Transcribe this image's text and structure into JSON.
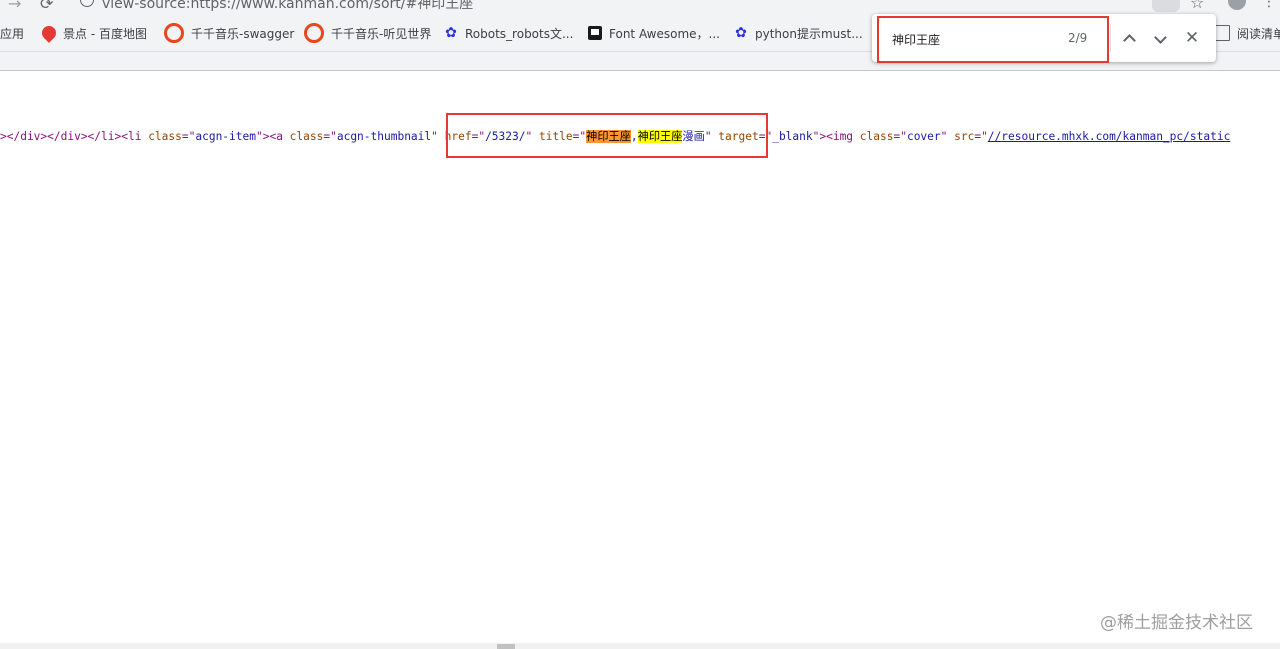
{
  "browser": {
    "url": "view-source:https://www.kanman.com/sort/#神印王座"
  },
  "bookmarks": [
    {
      "label": "应用",
      "icon": "apps-icon"
    },
    {
      "label": "景点 - 百度地图",
      "icon": "map-pin-icon"
    },
    {
      "label": "千千音乐-swagger",
      "icon": "qianqian-icon"
    },
    {
      "label": "千千音乐-听见世界",
      "icon": "qianqian-icon"
    },
    {
      "label": "Robots_robots文...",
      "icon": "baidu-paw-icon"
    },
    {
      "label": "Font Awesome，...",
      "icon": "flag-icon"
    },
    {
      "label": "python提示must...",
      "icon": "baidu-paw-icon"
    },
    {
      "label": "阅读清单",
      "icon": "reading-list-icon"
    }
  ],
  "find": {
    "query": "神印王座",
    "count": "2/9"
  },
  "source": {
    "t01": "></div></div></li><li ",
    "t02": "class",
    "t03": "=\"",
    "t04": "acgn-item",
    "t05": "\"><a ",
    "t06": "class",
    "t07": "=\"",
    "t08": "acgn-thumbnail",
    "t09": "\" ",
    "t10": "href",
    "t11": "=\"",
    "t12": "/5323/",
    "t13": "\" ",
    "t14": "title",
    "t15": "=\"",
    "t16": "神印王座",
    "t17": ",",
    "t18": "神印王座",
    "t19": "漫画",
    "t20": "\" ",
    "t21": "target",
    "t22": "=\"",
    "t23": "_blank",
    "t24": "\"><img ",
    "t25": "class",
    "t26": "=\"",
    "t27": "cover",
    "t28": "\" ",
    "t29": "src",
    "t30": "=\"",
    "t31": "//resource.mhxk.com/kanman_pc/static"
  },
  "watermark": "@稀土掘金技术社区"
}
